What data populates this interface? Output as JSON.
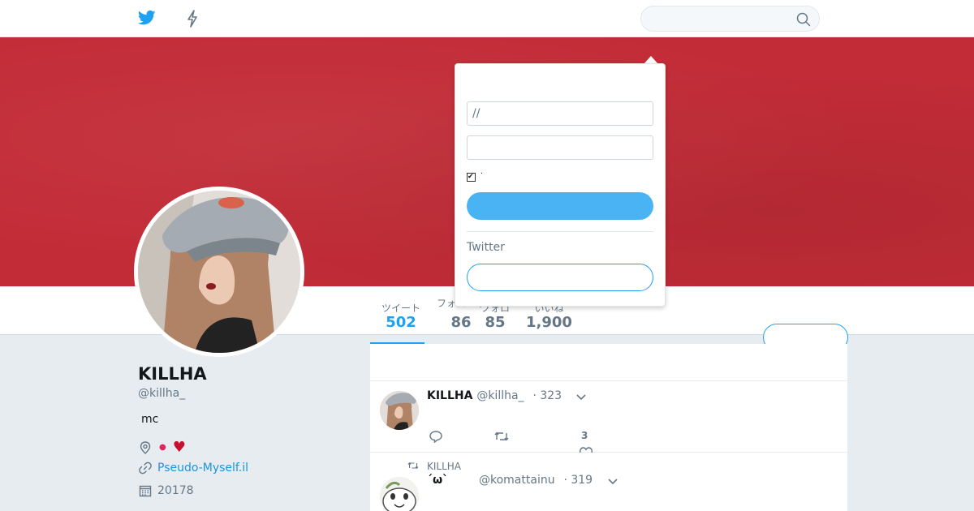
{
  "nav": {
    "home_icon": "twitter-bird-icon",
    "moments_icon": "lightning-bolt-icon",
    "search": {
      "placeholder": "",
      "icon": "search-icon"
    }
  },
  "profile": {
    "name": "KILLHA",
    "handle": "@killha_",
    "bio": "mc",
    "location_text": "●",
    "location_emoji": "♥",
    "link": "Pseudo-Myself.il",
    "joined": "20178"
  },
  "stats": [
    {
      "label": "ツイート",
      "value": "502"
    },
    {
      "label": "フォロー中",
      "value": "86"
    },
    {
      "label": "フォロ",
      "value": "85"
    },
    {
      "label": "いいね",
      "value": "1,900"
    }
  ],
  "follow_button": {
    "label": ""
  },
  "tweets": [
    {
      "name": "KILLHA",
      "handle": "@killha_",
      "time": "· 323",
      "like_count": "3"
    },
    {
      "retweeted_by": "KILLHA",
      "name": "´ω`",
      "handle": "@komattainu",
      "time": "· 319"
    }
  ],
  "login": {
    "username_value": "//",
    "password_value": "",
    "remember_label": "·",
    "login_button": "",
    "signup_prompt": "Twitter",
    "signup_button": ""
  },
  "colors": {
    "accent": "#1da1f2",
    "banner": "#c22c37",
    "heart": "#e0245e"
  }
}
